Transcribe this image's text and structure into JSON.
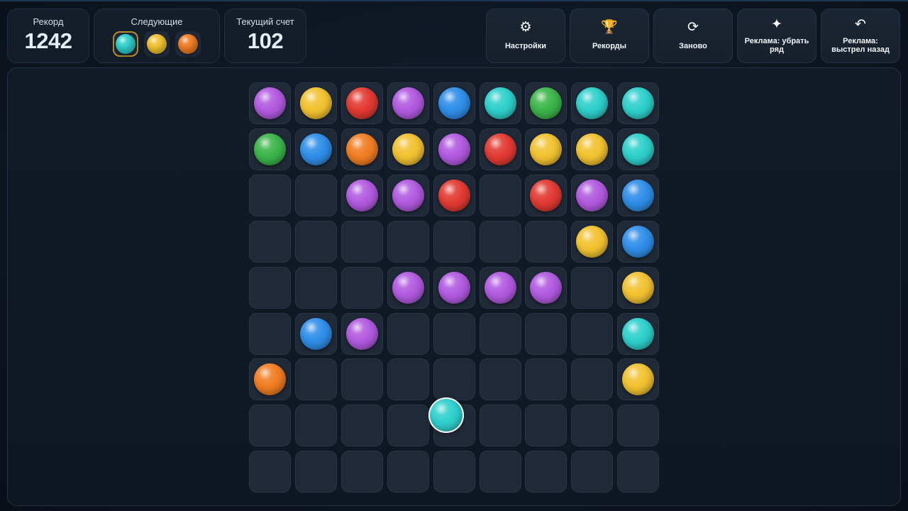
{
  "stats": {
    "record_label": "Рекорд",
    "record_value": "1242",
    "next_label": "Следующие",
    "score_label": "Текущий счет",
    "score_value": "102"
  },
  "next_balls": [
    "cyan",
    "yellow",
    "orange"
  ],
  "buttons": [
    {
      "name": "settings-button",
      "icon_name": "gear-icon",
      "icon": "⚙",
      "label": "Настройки"
    },
    {
      "name": "records-button",
      "icon_name": "trophy-icon",
      "icon": "🏆",
      "label": "Рекорды"
    },
    {
      "name": "restart-button",
      "icon_name": "restart-icon",
      "icon": "⟳",
      "label": "Заново"
    },
    {
      "name": "ad-remove-row-button",
      "icon_name": "sparkle-icon",
      "icon": "✦",
      "label": "Реклама: убрать ряд"
    },
    {
      "name": "ad-undo-shot-button",
      "icon_name": "undo-icon",
      "icon": "↶",
      "label": "Реклама: выстрел назад"
    }
  ],
  "colors": {
    "purple": "#b25ae0",
    "yellow": "#f2c230",
    "red": "#e23a32",
    "blue": "#2f8ee8",
    "cyan": "#2ed0cc",
    "green": "#3bb54a",
    "orange": "#f07d22"
  },
  "board": {
    "rows": [
      [
        "purple",
        "yellow",
        "red",
        "purple",
        "blue",
        "cyan",
        "green",
        "cyan",
        "cyan"
      ],
      [
        "green",
        "blue",
        "orange",
        "yellow",
        "purple",
        "red",
        "yellow",
        "yellow",
        "cyan"
      ],
      [
        null,
        null,
        "purple",
        "purple",
        "red",
        null,
        "red",
        "purple",
        "blue"
      ],
      [
        null,
        null,
        null,
        null,
        null,
        null,
        null,
        "yellow",
        "blue"
      ],
      [
        null,
        null,
        null,
        "purple",
        "purple",
        "purple",
        "purple",
        null,
        "yellow"
      ],
      [
        null,
        "blue",
        "purple",
        null,
        null,
        null,
        null,
        null,
        "cyan"
      ],
      [
        "orange",
        null,
        null,
        null,
        null,
        null,
        null,
        null,
        "yellow"
      ],
      [
        null,
        null,
        null,
        null,
        null,
        null,
        null,
        null,
        null
      ],
      [
        null,
        null,
        null,
        null,
        null,
        null,
        null,
        null,
        null
      ]
    ],
    "shooter_color": "cyan"
  }
}
